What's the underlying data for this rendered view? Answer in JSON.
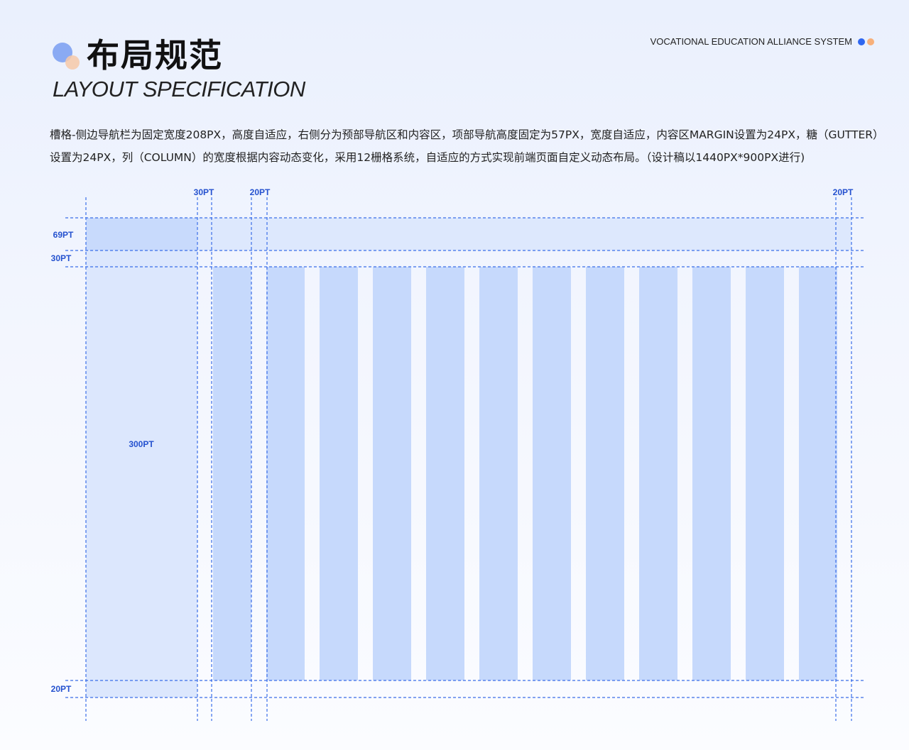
{
  "header": {
    "title_cn": "布局规范",
    "title_en": "LAYOUT SPECIFICATION",
    "brand": "VOCATIONAL EDUCATION ALLIANCE SYSTEM"
  },
  "description": "槽格-侧边导航栏为固定宽度208PX，高度自适应，右侧分为预部导航区和内容区，项部导航高度固定为57PX，宽度自适应，内容区MARGIN设置为24PX，糖（GUTTER）设置为24PX，列（COLUMN）的宽度根据内容动态变化，采用12栅格系统，自适应的方式实现前端页面自定义动态布局。（设计稿以1440PX*900PX进行)",
  "diagram": {
    "top_labels": [
      "30PT",
      "20PT",
      "20PT"
    ],
    "side_labels": [
      "69PT",
      "30PT",
      "20PT"
    ],
    "sidebar_label": "300PT",
    "column_count": 12
  },
  "colors": {
    "accent": "#2f67f0",
    "guide_line": "#3a6ee8",
    "label": "#2451cf",
    "sidebar_fill": "#dce7fd",
    "header_fill": "#dde8fd",
    "column_fill": "#c6d9fc",
    "deco_orange": "#f7b07a"
  }
}
